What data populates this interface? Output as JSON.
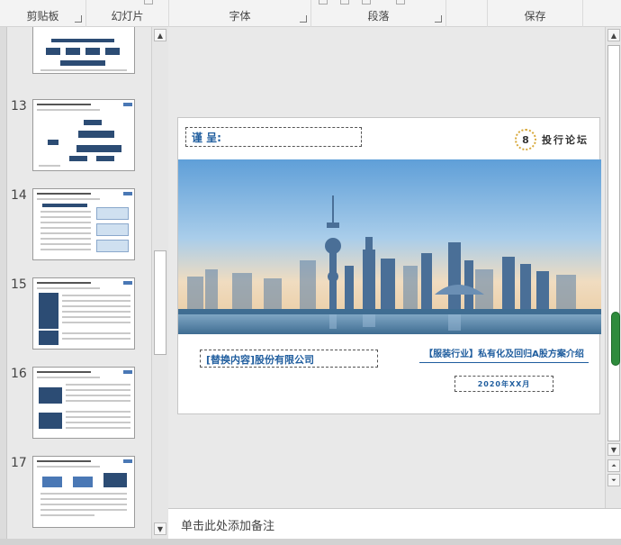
{
  "ribbon": {
    "groups": [
      {
        "label": "剪贴板"
      },
      {
        "label": "幻灯片"
      },
      {
        "label": "字体"
      },
      {
        "label": "段落"
      },
      {
        "label": "保存"
      }
    ]
  },
  "thumbnails": [
    {
      "num": "13"
    },
    {
      "num": "14"
    },
    {
      "num": "15"
    },
    {
      "num": "16"
    },
    {
      "num": "17"
    }
  ],
  "slide": {
    "recipient": "谨 呈:",
    "logo_text": "投行论坛",
    "logo_mark": "8",
    "company": "[替换内容]股份有限公司",
    "title": "【服装行业】私有化及回归A股方案介绍",
    "date": "2020年XX月"
  },
  "notes": {
    "placeholder": "单击此处添加备注"
  },
  "colors": {
    "accent": "#1f5d9e",
    "ribbon_bg": "#f3f3f3",
    "zoom_grip": "#2e8b3c"
  }
}
